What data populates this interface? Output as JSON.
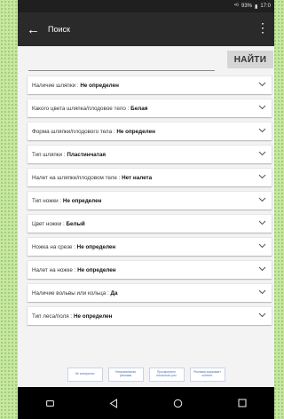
{
  "status_bar": {
    "signal": "⁴ᴳ",
    "battery": "93%",
    "time": "17:0"
  },
  "app_bar": {
    "back_icon": "arrow-back-icon",
    "title": "Поиск",
    "menu_icon": "more-vert-icon"
  },
  "search": {
    "value": "",
    "placeholder": "",
    "button_label": "НАЙТИ"
  },
  "filters": [
    {
      "label": "Наличие шляпки : ",
      "value": "Не определен"
    },
    {
      "label": "Какого цвета шляпка/плодовое тело : ",
      "value": "Белая"
    },
    {
      "label": "Форма шляпки/плодового тела : ",
      "value": "Не определен"
    },
    {
      "label": "Тип шляпки : ",
      "value": "Пластинчатая"
    },
    {
      "label": "Налет на шляпке/плодовом теле : ",
      "value": "Нет налета"
    },
    {
      "label": "Тип ножки : ",
      "value": "Не определен"
    },
    {
      "label": "Цвет ножки : ",
      "value": "Белый"
    },
    {
      "label": "Ножка на срезе : ",
      "value": "Не определен"
    },
    {
      "label": "Налет на ножке : ",
      "value": "Не определен"
    },
    {
      "label": "Наличие вольвы или кольца : ",
      "value": "Да"
    },
    {
      "label": "Тип леса/поля : ",
      "value": "Не определен"
    }
  ],
  "ad_bar": {
    "buttons": [
      "Не интересно",
      "Неправильная реклама",
      "Просмотрено несколько раз",
      "Реклама закрывает контент"
    ]
  },
  "nav_bar": {
    "icons": [
      "recent-apps-icon",
      "back-icon",
      "home-icon",
      "overview-icon"
    ]
  },
  "colors": {
    "page_bg": "#c7e6a3",
    "app_bar": "#2a2a2a",
    "content_bg": "#f3f3f3",
    "ad_text": "#4a6fb3"
  }
}
